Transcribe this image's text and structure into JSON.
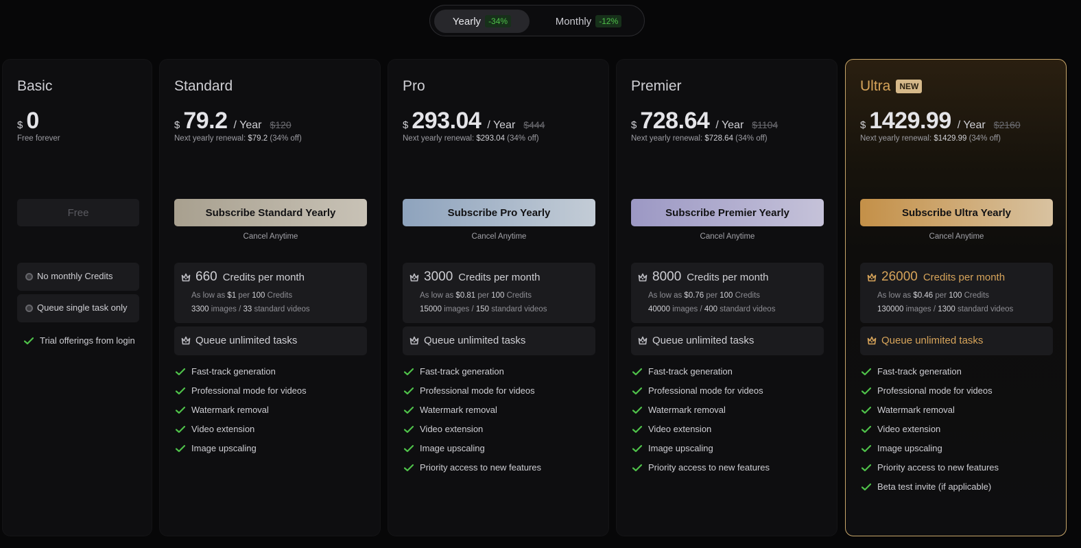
{
  "billing_toggle": {
    "yearly": {
      "label": "Yearly",
      "discount": "-34%"
    },
    "monthly": {
      "label": "Monthly",
      "discount": "-12%"
    }
  },
  "colors": {
    "accent_green": "#4fc24a",
    "ultra_gold": "#d7a45a",
    "background": "#070708"
  },
  "basic": {
    "name": "Basic",
    "currency": "$",
    "amount": "0",
    "note": "Free forever",
    "button": "Free",
    "limits": [
      "No monthly Credits",
      "Queue single task only"
    ],
    "features": [
      "Trial offerings from login"
    ]
  },
  "plans": [
    {
      "key": "standard",
      "name": "Standard",
      "currency": "$",
      "amount": "79.2",
      "period": "/ Year",
      "original": "$120",
      "renewal_prefix": "Next yearly renewal:",
      "renewal_amount": "$79.2",
      "renewal_suffix": "(34% off)",
      "button": "Subscribe Standard Yearly",
      "cancel": "Cancel Anytime",
      "credits": "660",
      "credits_label": "Credits per month",
      "as_low_prefix": "As low as",
      "per_price": "$1",
      "per_word": "per",
      "per_count": "100",
      "per_unit": "Credits",
      "images": "3300",
      "images_word": "images /",
      "videos": "33",
      "videos_word": "standard videos",
      "queue": "Queue unlimited tasks",
      "features": [
        "Fast-track generation",
        "Professional mode for videos",
        "Watermark removal",
        "Video extension",
        "Image upscaling"
      ]
    },
    {
      "key": "pro",
      "name": "Pro",
      "currency": "$",
      "amount": "293.04",
      "period": "/ Year",
      "original": "$444",
      "renewal_prefix": "Next yearly renewal:",
      "renewal_amount": "$293.04",
      "renewal_suffix": "(34% off)",
      "button": "Subscribe Pro Yearly",
      "cancel": "Cancel Anytime",
      "credits": "3000",
      "credits_label": "Credits per month",
      "as_low_prefix": "As low as",
      "per_price": "$0.81",
      "per_word": "per",
      "per_count": "100",
      "per_unit": "Credits",
      "images": "15000",
      "images_word": "images /",
      "videos": "150",
      "videos_word": "standard videos",
      "queue": "Queue unlimited tasks",
      "features": [
        "Fast-track generation",
        "Professional mode for videos",
        "Watermark removal",
        "Video extension",
        "Image upscaling",
        "Priority access to new features"
      ]
    },
    {
      "key": "premier",
      "name": "Premier",
      "currency": "$",
      "amount": "728.64",
      "period": "/ Year",
      "original": "$1104",
      "renewal_prefix": "Next yearly renewal:",
      "renewal_amount": "$728.64",
      "renewal_suffix": "(34% off)",
      "button": "Subscribe Premier Yearly",
      "cancel": "Cancel Anytime",
      "credits": "8000",
      "credits_label": "Credits per month",
      "as_low_prefix": "As low as",
      "per_price": "$0.76",
      "per_word": "per",
      "per_count": "100",
      "per_unit": "Credits",
      "images": "40000",
      "images_word": "images /",
      "videos": "400",
      "videos_word": "standard videos",
      "queue": "Queue unlimited tasks",
      "features": [
        "Fast-track generation",
        "Professional mode for videos",
        "Watermark removal",
        "Video extension",
        "Image upscaling",
        "Priority access to new features"
      ]
    },
    {
      "key": "ultra",
      "name": "Ultra",
      "badge": "NEW",
      "currency": "$",
      "amount": "1429.99",
      "period": "/ Year",
      "original": "$2160",
      "renewal_prefix": "Next yearly renewal:",
      "renewal_amount": "$1429.99",
      "renewal_suffix": "(34% off)",
      "button": "Subscribe Ultra Yearly",
      "cancel": "Cancel Anytime",
      "credits": "26000",
      "credits_label": "Credits per month",
      "as_low_prefix": "As low as",
      "per_price": "$0.46",
      "per_word": "per",
      "per_count": "100",
      "per_unit": "Credits",
      "images": "130000",
      "images_word": "images /",
      "videos": "1300",
      "videos_word": "standard videos",
      "queue": "Queue unlimited tasks",
      "features": [
        "Fast-track generation",
        "Professional mode for videos",
        "Watermark removal",
        "Video extension",
        "Image upscaling",
        "Priority access to new features",
        "Beta test invite (if applicable)"
      ]
    }
  ]
}
